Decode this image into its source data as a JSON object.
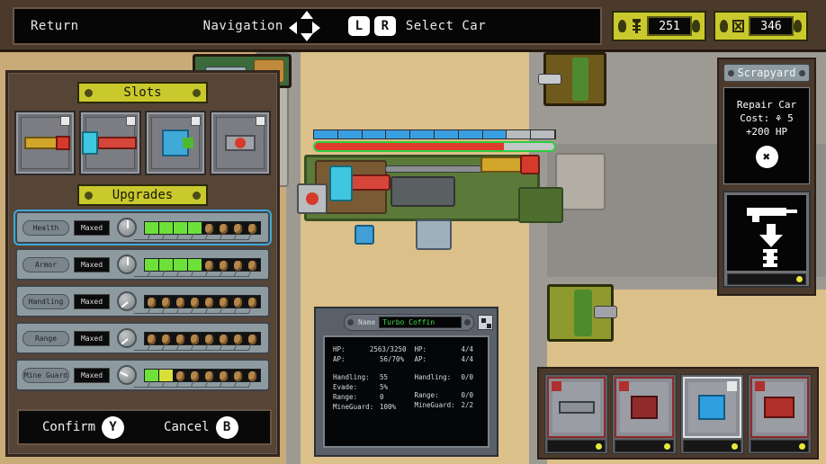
{
  "topbar": {
    "return_label": "Return",
    "navigation_label": "Navigation",
    "select_car_label": "Select Car",
    "key_l": "L",
    "key_r": "R",
    "resources": [
      {
        "icon": "bolt-screw-icon",
        "value": "251"
      },
      {
        "icon": "crate-parts-icon",
        "value": "346"
      }
    ]
  },
  "left_panel": {
    "slots_header": "Slots",
    "upgrades_header": "Upgrades",
    "slots": [
      {
        "name": "slot-weapon-1",
        "tag": "C",
        "weapon": "yellow-red-rocket"
      },
      {
        "name": "slot-weapon-2",
        "tag": "C",
        "weapon": "blue-cyan-launcher"
      },
      {
        "name": "slot-weapon-3",
        "tag": "C",
        "weapon": "blue-green-turret"
      },
      {
        "name": "slot-weapon-4",
        "tag": "C",
        "weapon": "red-mine-dropper"
      }
    ],
    "upgrades": [
      {
        "label": "Health",
        "button": "Maxed",
        "filled": 4,
        "partial": 0,
        "cost_slots": 4,
        "selected": true
      },
      {
        "label": "Armor",
        "button": "Maxed",
        "filled": 4,
        "partial": 0,
        "cost_slots": 4,
        "selected": false
      },
      {
        "label": "Handling",
        "button": "Maxed",
        "filled": 0,
        "partial": 0,
        "cost_slots": 8,
        "selected": false
      },
      {
        "label": "Range",
        "button": "Maxed",
        "filled": 0,
        "partial": 0,
        "cost_slots": 8,
        "selected": false
      },
      {
        "label": "Mine Guard",
        "button": "Maxed",
        "filled": 1,
        "partial": 1,
        "cost_slots": 6,
        "selected": false
      }
    ],
    "confirm_label": "Confirm",
    "confirm_key": "Y",
    "cancel_label": "Cancel",
    "cancel_key": "B"
  },
  "stats_panel": {
    "name_label": "Name",
    "name_value": "Turbo Coffin",
    "left_column": [
      {
        "key": "HP:",
        "value": "2563/3250"
      },
      {
        "key": "AP:",
        "value": "56/70%"
      },
      {
        "key": "",
        "value": ""
      },
      {
        "key": "Handling:",
        "value": "55"
      },
      {
        "key": "Evade:",
        "value": "5%"
      },
      {
        "key": "Range:",
        "value": "0"
      },
      {
        "key": "MineGuard:",
        "value": "100%"
      }
    ],
    "right_column": [
      {
        "key": "HP:",
        "value": "4/4"
      },
      {
        "key": "AP:",
        "value": "4/4"
      },
      {
        "key": "",
        "value": ""
      },
      {
        "key": "Handling:",
        "value": "0/0"
      },
      {
        "key": "",
        "value": ""
      },
      {
        "key": "Range:",
        "value": "0/0"
      },
      {
        "key": "MineGuard:",
        "value": "2/2"
      }
    ]
  },
  "scrapyard": {
    "title": "Scrapyard",
    "repair_line_1": "Repair Car",
    "repair_line_2": "Cost: ⚘ 5",
    "repair_line_3": "+200 HP",
    "repair_button_glyph": "✖",
    "sell_icon": "weapon-to-scrap-icon"
  },
  "inventory": {
    "slots": [
      {
        "name": "inventory-slot-1",
        "tag": "red",
        "weapon": "gray-gatling-gun",
        "selected": false
      },
      {
        "name": "inventory-slot-2",
        "tag": "red",
        "weapon": "red-mortar",
        "selected": false
      },
      {
        "name": "inventory-slot-3",
        "tag": "gray-C",
        "weapon": "blue-energy-gun",
        "selected": true
      },
      {
        "name": "inventory-slot-4",
        "tag": "red",
        "weapon": "red-twin-cannon",
        "selected": false
      }
    ]
  },
  "player_car": {
    "name": "player-convoy-truck",
    "ap_segments_total": 10,
    "ap_segments_filled": 8,
    "hp_percent": 79
  },
  "colors": {
    "panel_brown": "#4b3a2c",
    "yellow_header": "#c9c92e",
    "sand": "#dcc08a",
    "road_gray": "#9c9a93",
    "hp_red": "#e03a2f",
    "ap_blue": "#3a9fe0",
    "upgrade_green": "#6ee03a",
    "select_blue": "#3fa9d8",
    "name_green": "#39e04a"
  }
}
